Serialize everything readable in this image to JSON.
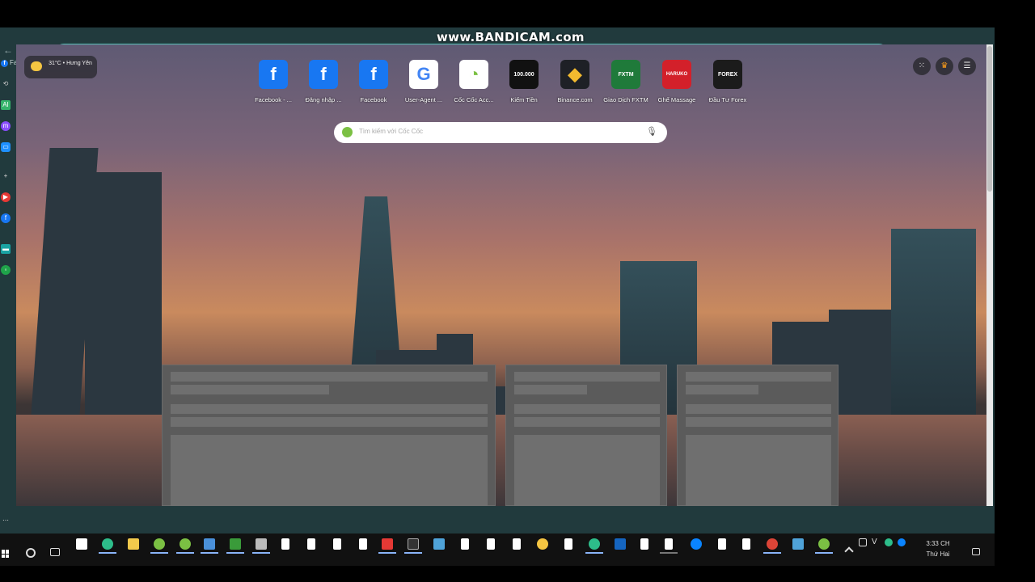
{
  "watermark": "www.BANDICAM.com",
  "bookmarks": [
    {
      "label": "Facebook"
    }
  ],
  "weather": {
    "text": "31°C • Hưng Yên"
  },
  "search": {
    "placeholder": "Tìm kiếm với Cốc Cốc"
  },
  "speed_dial": [
    {
      "label": "Facebook - ...",
      "icon": "facebook-icon",
      "color": "#1877f2"
    },
    {
      "label": "Đăng nhập ...",
      "icon": "facebook-icon",
      "color": "#1877f2"
    },
    {
      "label": "Facebook",
      "icon": "facebook-icon",
      "color": "#1877f2"
    },
    {
      "label": "User-Agent ...",
      "icon": "google-icon",
      "color": "#ffffff"
    },
    {
      "label": "Cốc Cốc Acc...",
      "icon": "coccoc-icon",
      "color": "#ffffff"
    },
    {
      "label": "Kiếm Tiền",
      "icon": "kiem-tien-icon",
      "color": "#111111",
      "badge": "100.000"
    },
    {
      "label": "Binance.com",
      "icon": "binance-icon",
      "color": "#1e2026"
    },
    {
      "label": "Giao Dịch FXTM",
      "icon": "fxtm-icon",
      "color": "#1f7a3a",
      "badge": "FXTM"
    },
    {
      "label": "Ghế Massage",
      "icon": "haruko-icon",
      "color": "#d3202a",
      "badge": "HARUKO"
    },
    {
      "label": "Đầu Tư Forex",
      "icon": "forex-icon",
      "color": "#1b1b1b",
      "badge": "FOREX"
    }
  ],
  "taskbar": {
    "time": "3:33 CH",
    "day": "Thứ Hai"
  }
}
